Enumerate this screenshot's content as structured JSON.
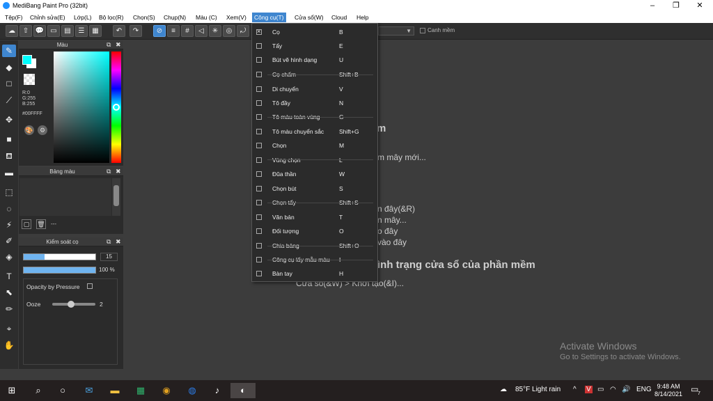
{
  "window": {
    "title": "MediBang Paint Pro (32bit)"
  },
  "menubar": [
    "Tệp(F)",
    "Chỉnh sửa(E)",
    "Lớp(L)",
    "Bộ lọc(R)",
    "Chọn(S)",
    "Chụp(N)",
    "Màu (C)",
    "Xem(V)",
    "Công cụ(T)",
    "Cửa sổ(W)",
    "Cloud",
    "Help"
  ],
  "toolbar": {
    "snap_label": "Canh mềm"
  },
  "color_panel": {
    "title": "Màu",
    "r": "R:0",
    "g": "G:255",
    "b": "B:255",
    "hex": "#00FFFF",
    "fg_color": "#00ffff"
  },
  "palette_panel": {
    "title": "Bảng màu",
    "footer_text": "---"
  },
  "brush_panel": {
    "title": "Kiểm soát cọ",
    "size": "15",
    "opacity": "100 %",
    "opacity_pressure_label": "Opacity by Pressure",
    "ooze_label": "Ooze",
    "ooze_value": "2"
  },
  "canvas_bg_text": [
    "m",
    "m mây mới...",
    "n đây(&R)",
    "n mây...",
    "o đây",
    "vào đây",
    "ình trạng cửa sổ của phần mềm",
    "Cửa sổ(&W) > Khởi tạo(&I)..."
  ],
  "dropdown": {
    "items": [
      {
        "label": "Cọ",
        "shortcut": "B",
        "checked": true
      },
      {
        "label": "Tẩy",
        "shortcut": "E",
        "checked": false
      },
      {
        "label": "Bút vẽ hình dạng",
        "shortcut": "U",
        "checked": false
      },
      {
        "label": "Cọ chấm",
        "shortcut": "Shift+B",
        "checked": false
      },
      {
        "label": "Di chuyển",
        "shortcut": "V",
        "checked": false
      },
      {
        "label": "Tô đầy",
        "shortcut": "N",
        "checked": false
      },
      {
        "label": "Tô màu toàn vùng",
        "shortcut": "G",
        "checked": false
      },
      {
        "label": "Tô màu chuyển sắc",
        "shortcut": "Shift+G",
        "checked": false
      },
      {
        "label": "Chọn",
        "shortcut": "M",
        "checked": false
      },
      {
        "label": "Vùng chọn",
        "shortcut": "L",
        "checked": false
      },
      {
        "label": "Đũa thần",
        "shortcut": "W",
        "checked": false
      },
      {
        "label": "Chọn bút",
        "shortcut": "S",
        "checked": false
      },
      {
        "label": "Chọn tẩy",
        "shortcut": "Shift+S",
        "checked": false
      },
      {
        "label": "Văn bản",
        "shortcut": "T",
        "checked": false
      },
      {
        "label": "Đối tượng",
        "shortcut": "O",
        "checked": false
      },
      {
        "label": "Chia bảng",
        "shortcut": "Shift+O",
        "checked": false
      },
      {
        "label": "Công cụ lấy mẫu màu",
        "shortcut": "I",
        "checked": false
      },
      {
        "label": "Bàn tay",
        "shortcut": "H",
        "checked": false
      }
    ]
  },
  "watermark": {
    "line1": "Activate Windows",
    "line2": "Go to Settings to activate Windows."
  },
  "taskbar": {
    "weather": "85°F  Light rain",
    "lang": "ENG",
    "time": "9:48 AM",
    "date": "8/14/2021",
    "notif_count": "7"
  },
  "colors": {
    "accent": "#3f86cf"
  }
}
